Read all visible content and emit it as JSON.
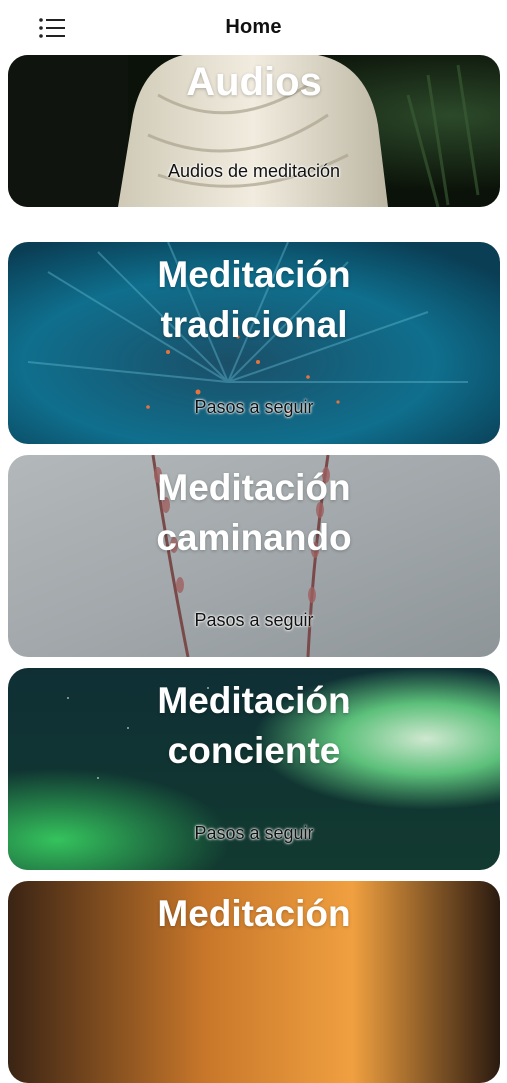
{
  "header": {
    "title": "Home",
    "menu_icon": "list-menu-icon"
  },
  "cards": [
    {
      "title": "Audios",
      "subtitle": "Audios de meditación"
    },
    {
      "title": "Meditación\ntradicional",
      "subtitle": "Pasos a seguir"
    },
    {
      "title": "Meditación\ncaminando",
      "subtitle": "Pasos a seguir"
    },
    {
      "title": "Meditación\nconciente",
      "subtitle": "Pasos a seguir"
    },
    {
      "title": "Meditación",
      "subtitle": ""
    }
  ],
  "colors": {
    "header_bg": "#ffffff",
    "title_text": "#111111",
    "card_title_text": "#ffffff"
  }
}
